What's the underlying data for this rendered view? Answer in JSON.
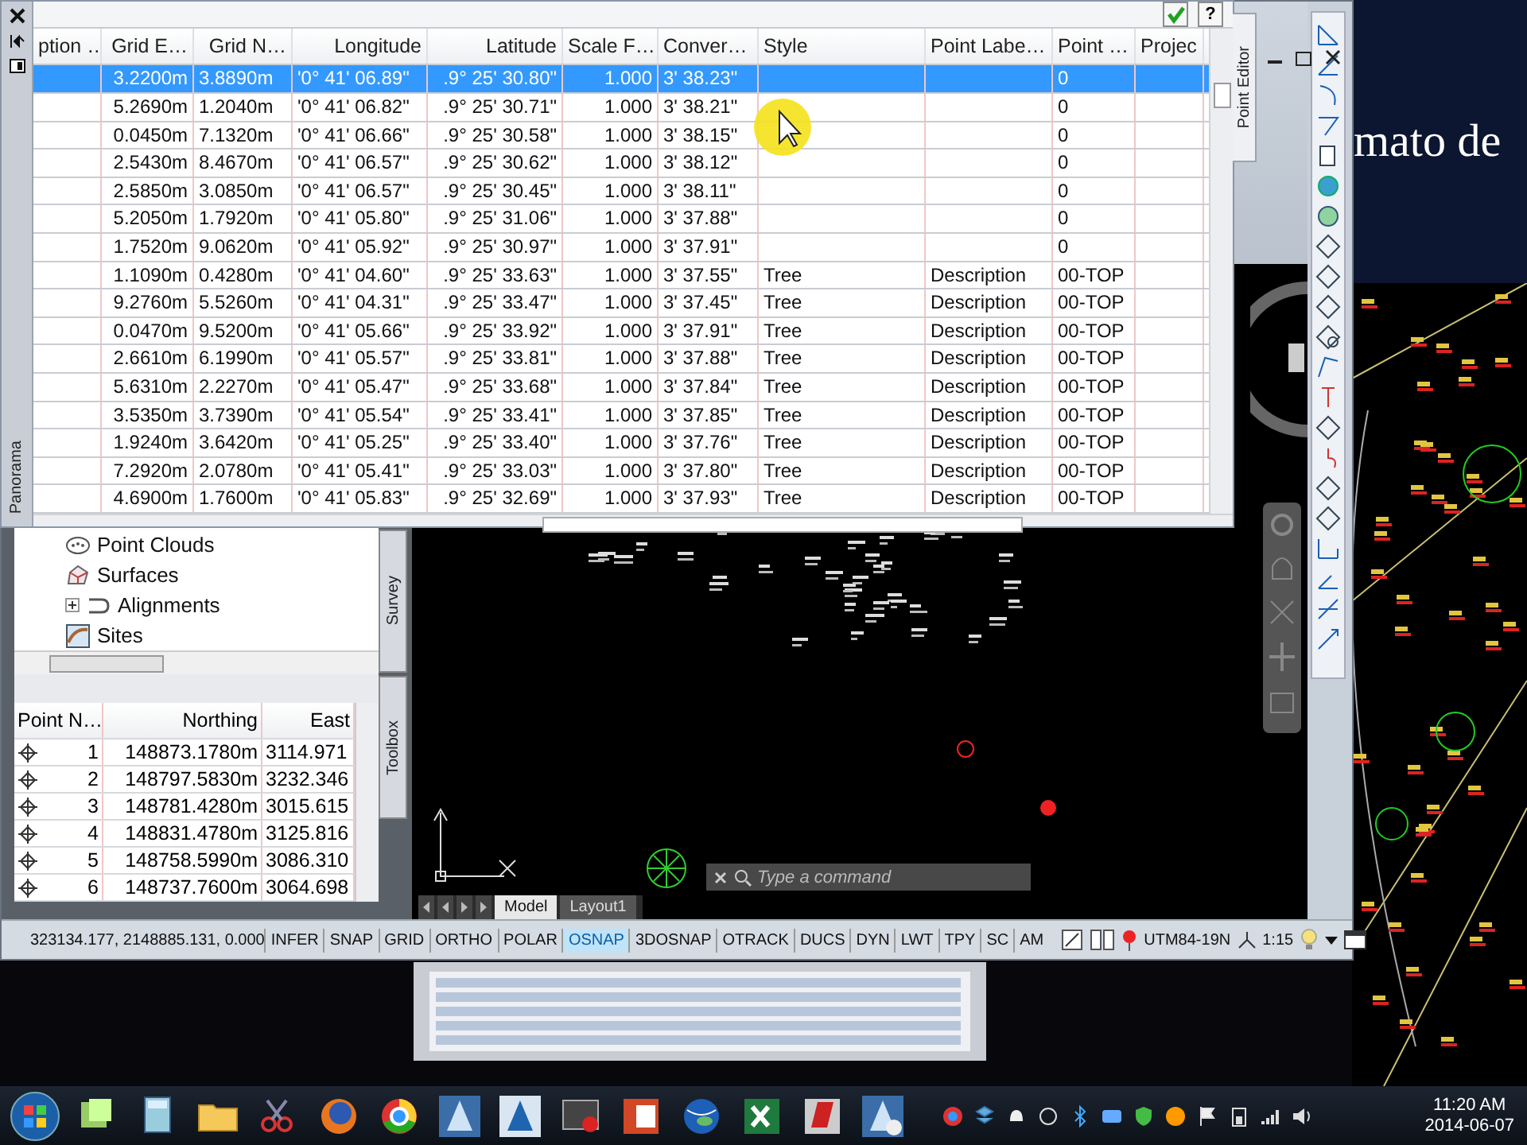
{
  "point_editor": {
    "side_label": "Panorama",
    "tab_label": "Point Editor",
    "help_button": "?",
    "columns": [
      "ption …",
      "Grid E…",
      "Grid N…",
      "Longitude",
      "Latitude",
      "Scale F…",
      "Conver…",
      "Style",
      "Point Labe…",
      "Point …",
      "Projec"
    ],
    "rows": [
      {
        "grid_easting": "3.2200m",
        "grid_northing": "3.8890m",
        "longitude": "'0° 41' 06.89\"",
        "latitude": ".9° 25' 30.80\"",
        "scale_factor": "1.000",
        "convergence": "3' 38.23\"",
        "point_column": "0",
        "selected": true
      },
      {
        "grid_easting": "5.2690m",
        "grid_northing": "1.2040m",
        "longitude": "'0° 41' 06.82\"",
        "latitude": ".9° 25' 30.71\"",
        "scale_factor": "1.000",
        "convergence": "3' 38.21\"",
        "point_column": "0",
        "selected": false
      },
      {
        "grid_easting": "0.0450m",
        "grid_northing": "7.1320m",
        "longitude": "'0° 41' 06.66\"",
        "latitude": ".9° 25' 30.58\"",
        "scale_factor": "1.000",
        "convergence": "3' 38.15\"",
        "point_column": "0",
        "selected": false
      },
      {
        "grid_easting": "2.5430m",
        "grid_northing": "8.4670m",
        "longitude": "'0° 41' 06.57\"",
        "latitude": ".9° 25' 30.62\"",
        "scale_factor": "1.000",
        "convergence": "3' 38.12\"",
        "point_column": "0",
        "selected": false
      },
      {
        "grid_easting": "2.5850m",
        "grid_northing": "3.0850m",
        "longitude": "'0° 41' 06.57\"",
        "latitude": ".9° 25' 30.45\"",
        "scale_factor": "1.000",
        "convergence": "3' 38.11\"",
        "point_column": "0",
        "selected": false
      },
      {
        "grid_easting": "5.2050m",
        "grid_northing": "1.7920m",
        "longitude": "'0° 41' 05.80\"",
        "latitude": ".9° 25' 31.06\"",
        "scale_factor": "1.000",
        "convergence": "3' 37.88\"",
        "point_column": "0",
        "selected": false
      },
      {
        "grid_easting": "1.7520m",
        "grid_northing": "9.0620m",
        "longitude": "'0° 41' 05.92\"",
        "latitude": ".9° 25' 30.97\"",
        "scale_factor": "1.000",
        "convergence": "3' 37.91\"",
        "point_column": "0",
        "selected": false
      },
      {
        "grid_easting": "1.1090m",
        "grid_northing": "0.4280m",
        "longitude": "'0° 41' 04.60\"",
        "latitude": ".9° 25' 33.63\"",
        "scale_factor": "1.000",
        "convergence": "3' 37.55\"",
        "style": "Tree",
        "point_label_style": "Description",
        "point_column": "00-TOP",
        "selected": false
      },
      {
        "grid_easting": "9.2760m",
        "grid_northing": "5.5260m",
        "longitude": "'0° 41' 04.31\"",
        "latitude": ".9° 25' 33.47\"",
        "scale_factor": "1.000",
        "convergence": "3' 37.45\"",
        "style": "Tree",
        "point_label_style": "Description",
        "point_column": "00-TOP",
        "selected": false
      },
      {
        "grid_easting": "0.0470m",
        "grid_northing": "9.5200m",
        "longitude": "'0° 41' 05.66\"",
        "latitude": ".9° 25' 33.92\"",
        "scale_factor": "1.000",
        "convergence": "3' 37.91\"",
        "style": "Tree",
        "point_label_style": "Description",
        "point_column": "00-TOP",
        "selected": false
      },
      {
        "grid_easting": "2.6610m",
        "grid_northing": "6.1990m",
        "longitude": "'0° 41' 05.57\"",
        "latitude": ".9° 25' 33.81\"",
        "scale_factor": "1.000",
        "convergence": "3' 37.88\"",
        "style": "Tree",
        "point_label_style": "Description",
        "point_column": "00-TOP",
        "selected": false
      },
      {
        "grid_easting": "5.6310m",
        "grid_northing": "2.2270m",
        "longitude": "'0° 41' 05.47\"",
        "latitude": ".9° 25' 33.68\"",
        "scale_factor": "1.000",
        "convergence": "3' 37.84\"",
        "style": "Tree",
        "point_label_style": "Description",
        "point_column": "00-TOP",
        "selected": false
      },
      {
        "grid_easting": "3.5350m",
        "grid_northing": "3.7390m",
        "longitude": "'0° 41' 05.54\"",
        "latitude": ".9° 25' 33.41\"",
        "scale_factor": "1.000",
        "convergence": "3' 37.85\"",
        "style": "Tree",
        "point_label_style": "Description",
        "point_column": "00-TOP",
        "selected": false
      },
      {
        "grid_easting": "1.9240m",
        "grid_northing": "3.6420m",
        "longitude": "'0° 41' 05.25\"",
        "latitude": ".9° 25' 33.40\"",
        "scale_factor": "1.000",
        "convergence": "3' 37.76\"",
        "style": "Tree",
        "point_label_style": "Description",
        "point_column": "00-TOP",
        "selected": false
      },
      {
        "grid_easting": "7.2920m",
        "grid_northing": "2.0780m",
        "longitude": "'0° 41' 05.41\"",
        "latitude": ".9° 25' 33.03\"",
        "scale_factor": "1.000",
        "convergence": "3' 37.80\"",
        "style": "Tree",
        "point_label_style": "Description",
        "point_column": "00-TOP",
        "selected": false
      },
      {
        "grid_easting": "4.6900m",
        "grid_northing": "1.7600m",
        "longitude": "'0° 41' 05.83\"",
        "latitude": ".9° 25' 32.69\"",
        "scale_factor": "1.000",
        "convergence": "3' 37.93\"",
        "style": "Tree",
        "point_label_style": "Description",
        "point_column": "00-TOP",
        "selected": false
      }
    ]
  },
  "toolspace": {
    "tree": [
      {
        "label": "Point Clouds",
        "kind": "cloud"
      },
      {
        "label": "Surfaces",
        "kind": "surface"
      },
      {
        "label": "Alignments",
        "kind": "alignment",
        "expanded": false
      },
      {
        "label": "Sites",
        "kind": "site"
      }
    ],
    "side_tabs": [
      "Survey",
      "Toolbox"
    ],
    "points_table": {
      "columns": [
        "Point N…",
        "Northing",
        "East"
      ],
      "rows": [
        {
          "number": "1",
          "northing": "148873.1780m",
          "easting": "3114.971"
        },
        {
          "number": "2",
          "northing": "148797.5830m",
          "easting": "3232.346"
        },
        {
          "number": "3",
          "northing": "148781.4280m",
          "easting": "3015.615"
        },
        {
          "number": "4",
          "northing": "148831.4780m",
          "easting": "3125.816"
        },
        {
          "number": "5",
          "northing": "148758.5990m",
          "easting": "3086.310"
        },
        {
          "number": "6",
          "northing": "148737.7600m",
          "easting": "3064.698"
        }
      ]
    }
  },
  "drawing": {
    "layout_tabs": [
      {
        "label": "Model",
        "selected": true
      },
      {
        "label": "Layout1",
        "selected": false
      }
    ],
    "command_line": {
      "placeholder": "Type a command"
    }
  },
  "status_bar": {
    "coordinates": "323134.177, 2148885.131, 0.000",
    "toggles": [
      {
        "label": "INFER",
        "on": false
      },
      {
        "label": "SNAP",
        "on": false
      },
      {
        "label": "GRID",
        "on": false
      },
      {
        "label": "ORTHO",
        "on": false
      },
      {
        "label": "POLAR",
        "on": false
      },
      {
        "label": "OSNAP",
        "on": true
      },
      {
        "label": "3DOSNAP",
        "on": false
      },
      {
        "label": "OTRACK",
        "on": false
      },
      {
        "label": "DUCS",
        "on": false
      },
      {
        "label": "DYN",
        "on": false
      },
      {
        "label": "LWT",
        "on": false
      },
      {
        "label": "TPY",
        "on": false
      },
      {
        "label": "SC",
        "on": false
      },
      {
        "label": "AM",
        "on": false
      }
    ],
    "coordinate_system": "UTM84-19N",
    "scale": "1:15"
  },
  "slide": {
    "text": "mato de"
  },
  "taskbar": {
    "clock": {
      "time": "11:20 AM",
      "date": "2014-06-07"
    }
  }
}
